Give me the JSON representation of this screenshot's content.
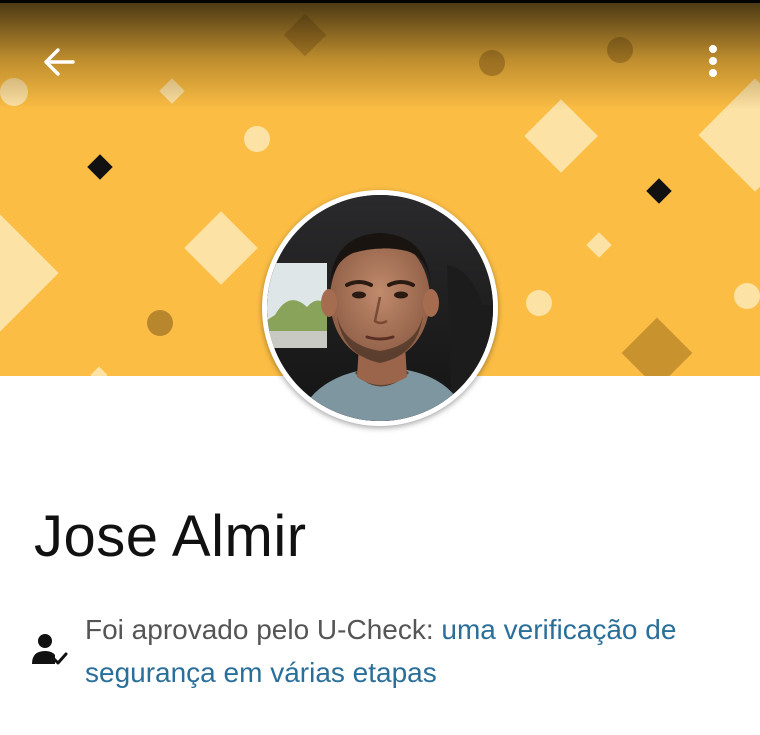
{
  "header": {
    "background_color": "#fbbd44",
    "back_icon": "arrow-left-icon",
    "menu_icon": "more-vertical-icon"
  },
  "profile": {
    "name": "Jose Almir",
    "avatar": "driver-profile-photo"
  },
  "verification": {
    "icon": "person-check-icon",
    "text": "Foi aprovado pelo U-Check: ",
    "link_text": "uma verificação de segurança em várias etapas",
    "link_color": "#2a6f9a"
  }
}
